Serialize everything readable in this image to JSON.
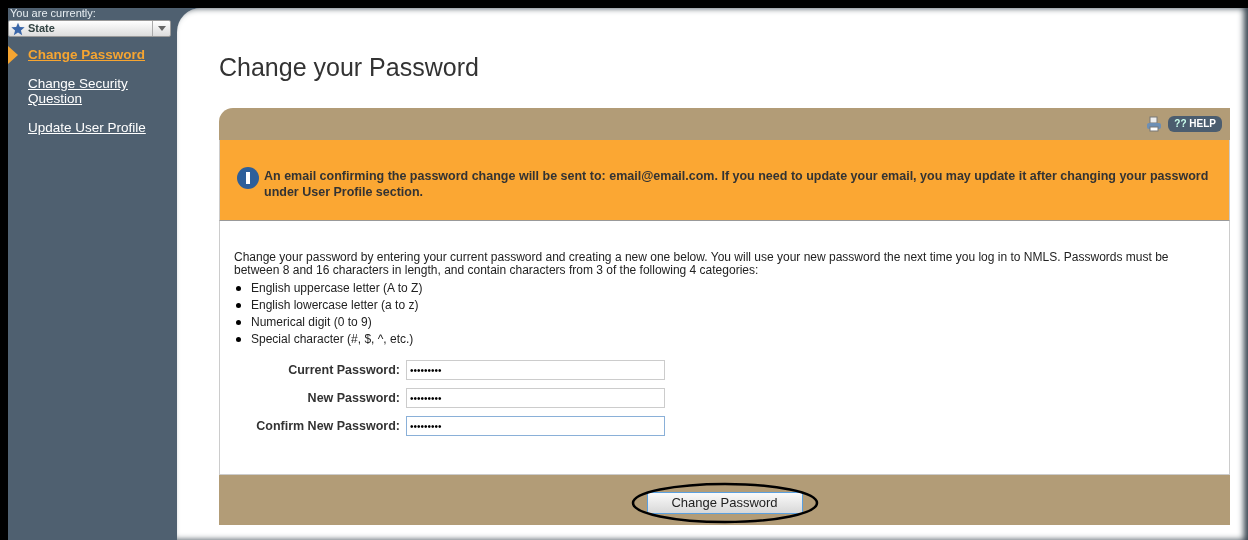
{
  "sidebar": {
    "context_label": "You are currently:",
    "context_select": {
      "value": "State"
    },
    "items": [
      {
        "label": "Change Password",
        "selected": true
      },
      {
        "label": "Change Security Question",
        "selected": false
      },
      {
        "label": "Update User Profile",
        "selected": false
      }
    ]
  },
  "page_title": "Change your Password",
  "toolbar": {
    "help_label": "HELP",
    "help_icon_text": "??"
  },
  "notice": "An email confirming the password change will be sent to: email@email.com. If you need to update your email, you may update it after changing your password under User Profile section.",
  "instructions": "Change your password by entering your current password and creating a new one below. You will use your new password the next time you log in to NMLS. Passwords must be between 8 and 16 characters in length, and contain characters from 3 of the following 4 categories:",
  "categories": [
    "English uppercase letter (A to Z)",
    "English lowercase letter (a to z)",
    "Numerical digit (0 to 9)",
    "Special character (#, $, ^, etc.)"
  ],
  "fields": [
    {
      "label": "Current Password:",
      "value": "•••••••••",
      "focused": false
    },
    {
      "label": "New Password:",
      "value": "•••••••••",
      "focused": false
    },
    {
      "label": "Confirm New Password:",
      "value": "•••••••••",
      "focused": true
    }
  ],
  "submit_button": "Change Password"
}
